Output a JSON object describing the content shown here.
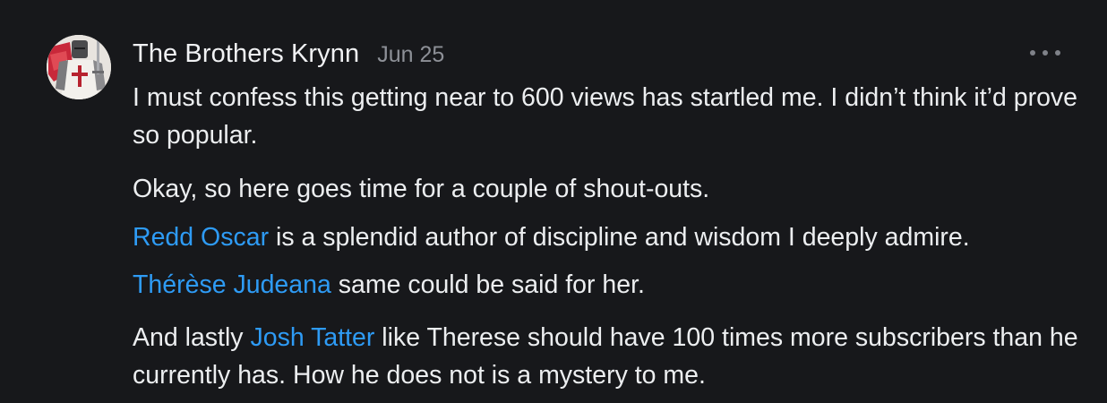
{
  "comment": {
    "author": "The Brothers Krynn",
    "date": "Jun 25",
    "more_icon": "ellipsis-icon",
    "paragraphs": {
      "p1": "I must confess this getting near to 600 views has startled me. I didn’t think it’d prove so popular.",
      "p2": "Okay, so here goes time for a couple of shout-outs.",
      "p3": {
        "mention": "Redd Oscar",
        "text": " is a splendid author of discipline and wisdom I deeply admire."
      },
      "p4": {
        "mention": "Thérèse Judeana",
        "text": " same could be said for her."
      },
      "p5": {
        "before": "And lastly ",
        "mention": "Josh Tatter",
        "text": " like Therese should have 100 times more subscribers than he currently has. How he does not is a mystery to me."
      }
    }
  },
  "colors": {
    "background": "#17181b",
    "text": "#eceef0",
    "muted": "#8d9097",
    "mention": "#2e9bf5"
  }
}
